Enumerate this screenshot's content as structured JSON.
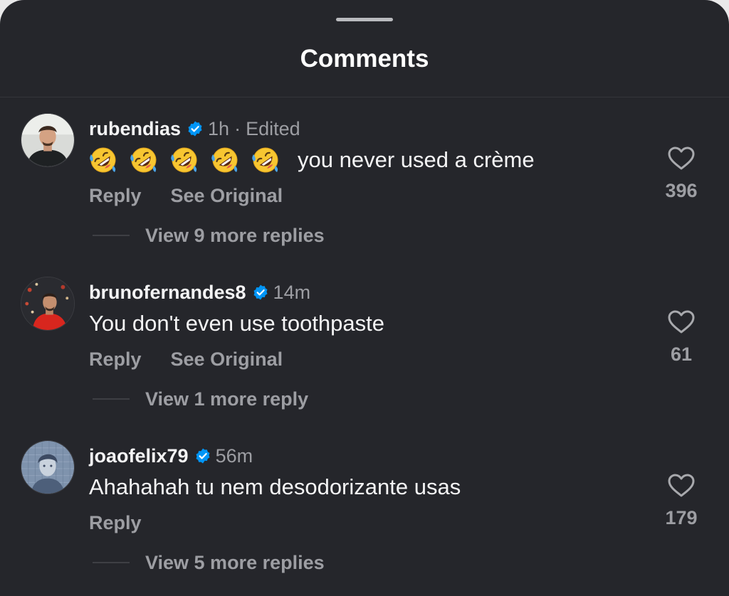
{
  "sheet": {
    "title": "Comments"
  },
  "comments": [
    {
      "username": "rubendias",
      "verified": true,
      "time": "1h",
      "separator": "·",
      "edited": "Edited",
      "emoji": [
        "rolling-on-floor-laughing",
        "rolling-on-floor-laughing",
        "rolling-on-floor-laughing",
        "rolling-on-floor-laughing",
        "rolling-on-floor-laughing"
      ],
      "text": "you never used a crème",
      "reply_label": "Reply",
      "see_original_label": "See Original",
      "likes": "396",
      "view_replies": "View 9 more replies"
    },
    {
      "username": "brunofernandes8",
      "verified": true,
      "time": "14m",
      "text": "You don't even use toothpaste",
      "reply_label": "Reply",
      "see_original_label": "See Original",
      "likes": "61",
      "view_replies": "View 1 more reply"
    },
    {
      "username": "joaofelix79",
      "verified": true,
      "time": "56m",
      "text": "Ahahahah tu nem desodorizante usas",
      "reply_label": "Reply",
      "likes": "179",
      "view_replies": "View 5 more replies"
    }
  ],
  "colors": {
    "background": "#25262b",
    "primary_text": "#f4f4f5",
    "secondary_text": "#9d9ea3",
    "verified_badge": "#0095f6",
    "grabber": "#b9babe"
  }
}
